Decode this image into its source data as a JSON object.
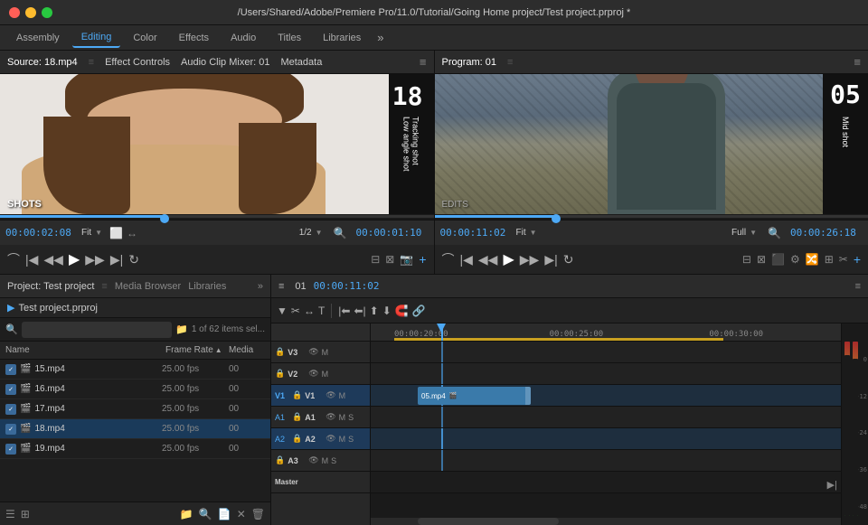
{
  "titlebar": {
    "title": "/Users/Shared/Adobe/Premiere Pro/11.0/Tutorial/Going Home project/Test project.prproj *"
  },
  "workspace_tabs": {
    "items": [
      "Assembly",
      "Editing",
      "Color",
      "Effects",
      "Audio",
      "Titles",
      "Libraries"
    ],
    "active": "Editing",
    "more": "»"
  },
  "source_monitor": {
    "tabs": [
      "Source: 18.mp4",
      "Effect Controls",
      "Audio Clip Mixer: 01",
      "Metadata"
    ],
    "active_tab": "Source: 18.mp4",
    "timecode": "00:00:02:08",
    "zoom": "Fit",
    "fraction": "1/2",
    "end_timecode": "00:00:01:10",
    "number_overlay": "18",
    "vertical_label": "Tracking shot\nLow angle shot",
    "shots_label": "SHOTS"
  },
  "program_monitor": {
    "title": "Program: 01",
    "timecode": "00:00:11:02",
    "zoom": "Fit",
    "full": "Full",
    "end_timecode": "00:00:26:18",
    "number_overlay": "05",
    "vertical_label": "Mid shot",
    "edits_label": "EDITS"
  },
  "project_panel": {
    "title": "Project: Test project",
    "tabs": [
      "Media Browser",
      "Libraries"
    ],
    "more": "»",
    "current_folder": "Test project.prproj",
    "search_placeholder": "",
    "item_count": "1 of 62 items sel...",
    "columns": {
      "name": "Name",
      "frame_rate": "Frame Rate",
      "media": "Media"
    },
    "files": [
      {
        "name": "15.mp4",
        "fps": "25.00 fps",
        "media": "00"
      },
      {
        "name": "16.mp4",
        "fps": "25.00 fps",
        "media": "00"
      },
      {
        "name": "17.mp4",
        "fps": "25.00 fps",
        "media": "00"
      },
      {
        "name": "18.mp4",
        "fps": "25.00 fps",
        "media": "00"
      },
      {
        "name": "19.mp4",
        "fps": "25.00 fps",
        "media": "00"
      }
    ]
  },
  "timeline": {
    "sequence": "01",
    "timecode": "00:00:11:02",
    "ruler_times": [
      "00:00:20:00",
      "00:00:25:00",
      "00:00:30:00"
    ],
    "tracks": {
      "video": [
        {
          "name": "V3",
          "type": "video"
        },
        {
          "name": "V2",
          "type": "video"
        },
        {
          "name": "V1",
          "type": "video",
          "selected": true
        }
      ],
      "audio": [
        {
          "name": "A1",
          "type": "audio"
        },
        {
          "name": "A2",
          "type": "audio",
          "selected": true
        },
        {
          "name": "A3",
          "type": "audio"
        }
      ]
    },
    "clip": {
      "name": "05.mp4",
      "left_pct": 10,
      "width_pct": 25
    },
    "vu_labels": [
      "0",
      "-12",
      "-24",
      "-36",
      "-48"
    ]
  },
  "buttons": {
    "play": "▶",
    "prev_frame": "◀",
    "next_frame": "▶",
    "mark_in": "I",
    "mark_out": "O",
    "step_back": "◀◀",
    "step_fwd": "▶▶",
    "loop": "↻"
  }
}
